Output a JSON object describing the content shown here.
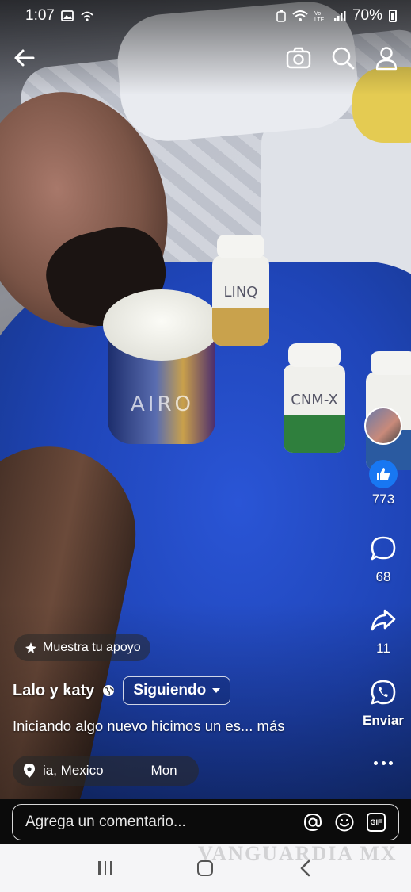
{
  "status_bar": {
    "time": "1:07",
    "battery": "70%",
    "icons": [
      "gallery-icon",
      "wifi-calling-icon",
      "wifi-icon",
      "volte-icon",
      "signal-icon",
      "battery-icon"
    ]
  },
  "top_bar": {
    "icons": [
      "back-arrow-icon",
      "camera-icon",
      "search-icon",
      "profile-icon"
    ]
  },
  "video": {
    "product_labels": [
      "AIRO",
      "LINQ",
      "CNM-X"
    ]
  },
  "actions": {
    "like_count": "773",
    "comment_count": "68",
    "share_count": "11",
    "send_label": "Enviar",
    "colors": {
      "like": "#1877f2"
    }
  },
  "post": {
    "support_label": "Muestra tu apoyo",
    "author": "Lalo y katy",
    "follow_label": "Siguiendo",
    "caption": "Iniciando algo nuevo hicimos un es...",
    "caption_more": "más",
    "location": "ia, Mexico",
    "location_extra": "Mon"
  },
  "comment_bar": {
    "placeholder": "Agrega un comentario..."
  },
  "watermark": "VANGUARDIA MX"
}
